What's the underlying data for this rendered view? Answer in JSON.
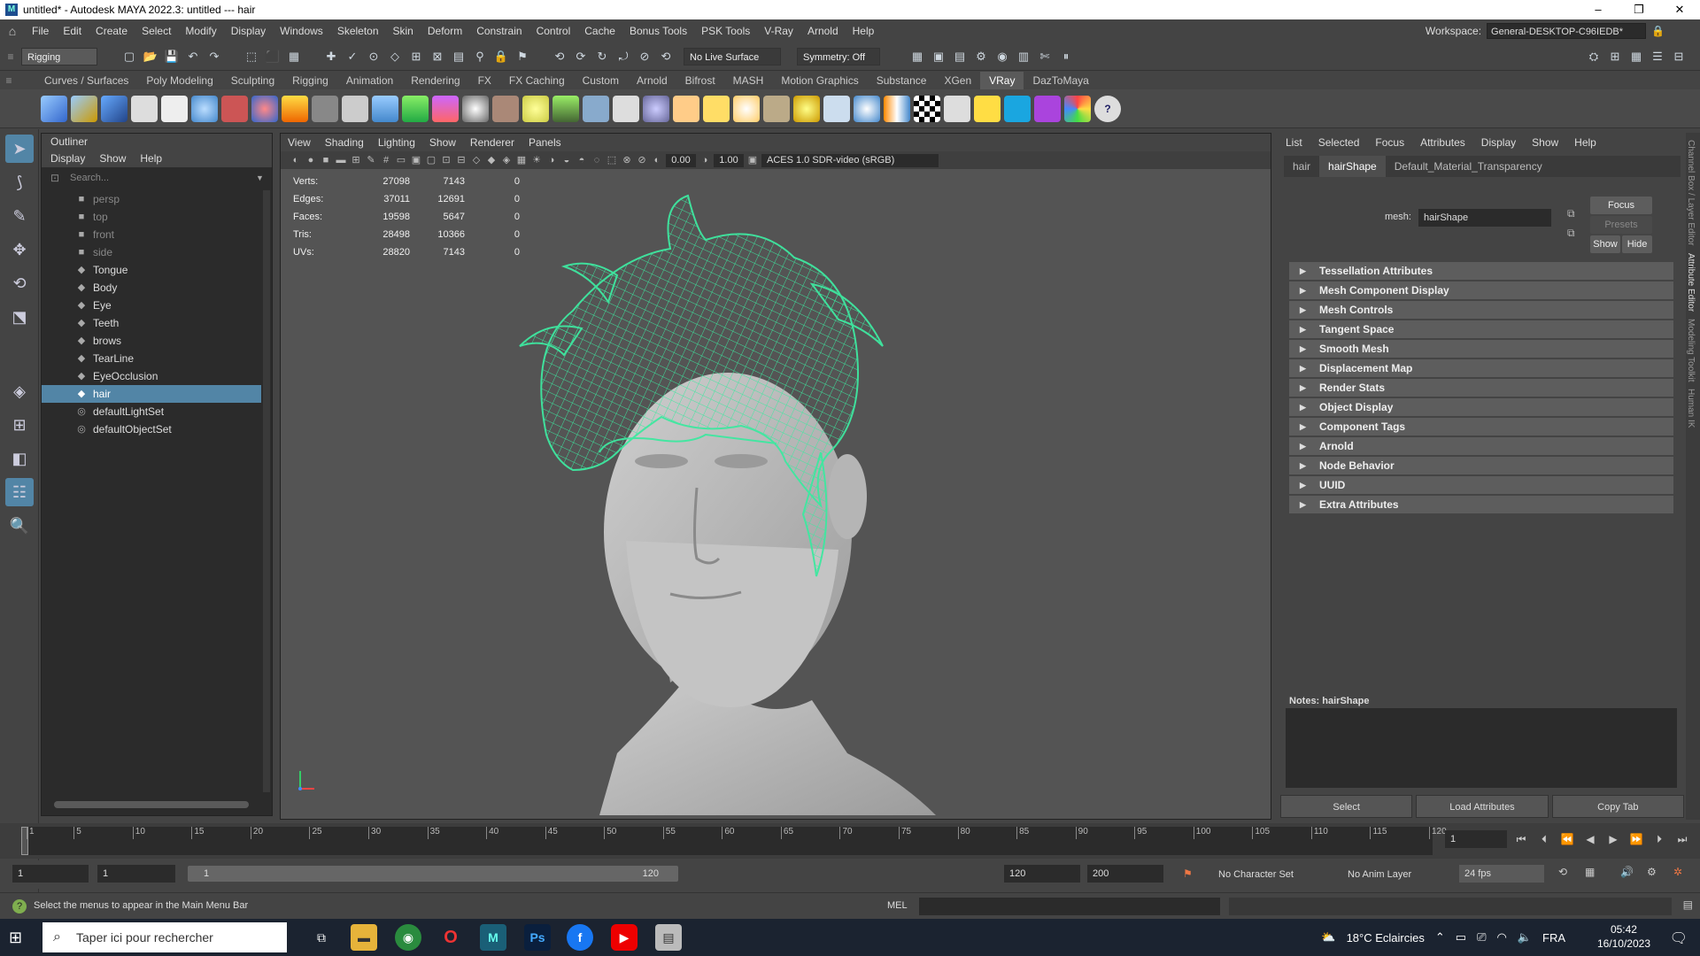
{
  "window": {
    "title": "untitled* - Autodesk MAYA 2022.3: untitled   ---   hair",
    "minimize": "–",
    "restore": "❐",
    "close": "✕"
  },
  "menubar": {
    "items": [
      "File",
      "Edit",
      "Create",
      "Select",
      "Modify",
      "Display",
      "Windows",
      "Skeleton",
      "Skin",
      "Deform",
      "Constrain",
      "Control",
      "Cache",
      "Bonus Tools",
      "PSK Tools",
      "V-Ray",
      "Arnold",
      "Help"
    ],
    "workspace_label": "Workspace:",
    "workspace_value": "General-DESKTOP-C96IEDB*"
  },
  "statusline": {
    "menuset": "Rigging",
    "live_surface": "No Live Surface",
    "symmetry": "Symmetry: Off"
  },
  "shelf_tabs": [
    "Curves / Surfaces",
    "Poly Modeling",
    "Sculpting",
    "Rigging",
    "Animation",
    "Rendering",
    "FX",
    "FX Caching",
    "Custom",
    "Arnold",
    "Bifrost",
    "MASH",
    "Motion Graphics",
    "Substance",
    "XGen",
    "VRay",
    "DazToMaya"
  ],
  "shelf_active_tab": "VRay",
  "outliner": {
    "title": "Outliner",
    "menu": [
      "Display",
      "Show",
      "Help"
    ],
    "search_placeholder": "Search...",
    "items": [
      {
        "label": "persp",
        "type": "camera"
      },
      {
        "label": "top",
        "type": "camera"
      },
      {
        "label": "front",
        "type": "camera"
      },
      {
        "label": "side",
        "type": "camera"
      },
      {
        "label": "Tongue",
        "type": "mesh"
      },
      {
        "label": "Body",
        "type": "mesh"
      },
      {
        "label": "Eye",
        "type": "mesh"
      },
      {
        "label": "Teeth",
        "type": "mesh"
      },
      {
        "label": "brows",
        "type": "mesh"
      },
      {
        "label": "TearLine",
        "type": "mesh"
      },
      {
        "label": "EyeOcclusion",
        "type": "mesh"
      },
      {
        "label": "hair",
        "type": "mesh",
        "selected": true
      },
      {
        "label": "defaultLightSet",
        "type": "set"
      },
      {
        "label": "defaultObjectSet",
        "type": "set"
      }
    ]
  },
  "viewport": {
    "menu": [
      "View",
      "Shading",
      "Lighting",
      "Show",
      "Renderer",
      "Panels"
    ],
    "exposure": "0.00",
    "gamma": "1.00",
    "color_space": "ACES 1.0 SDR-video (sRGB)",
    "hud": [
      {
        "label": "Verts:",
        "a": "27098",
        "b": "7143",
        "c": "0"
      },
      {
        "label": "Edges:",
        "a": "37011",
        "b": "12691",
        "c": "0"
      },
      {
        "label": "Faces:",
        "a": "19598",
        "b": "5647",
        "c": "0"
      },
      {
        "label": "Tris:",
        "a": "28498",
        "b": "10366",
        "c": "0"
      },
      {
        "label": "UVs:",
        "a": "28820",
        "b": "7143",
        "c": "0"
      }
    ],
    "wire_color": "#3ee8a0"
  },
  "attribute_editor": {
    "menu": [
      "List",
      "Selected",
      "Focus",
      "Attributes",
      "Display",
      "Show",
      "Help"
    ],
    "tabs": [
      "hair",
      "hairShape",
      "Default_Material_Transparency"
    ],
    "active_tab": "hairShape",
    "mesh_label": "mesh:",
    "mesh_value": "hairShape",
    "focus": "Focus",
    "presets": "Presets",
    "show": "Show",
    "hide": "Hide",
    "sections": [
      "Tessellation Attributes",
      "Mesh Component Display",
      "Mesh Controls",
      "Tangent Space",
      "Smooth Mesh",
      "Displacement Map",
      "Render Stats",
      "Object Display",
      "Component Tags",
      "Arnold",
      "Node Behavior",
      "UUID",
      "Extra Attributes"
    ],
    "notes_label": "Notes:  hairShape",
    "buttons": [
      "Select",
      "Load Attributes",
      "Copy Tab"
    ]
  },
  "side_tabs": [
    "Channel Box / Layer Editor",
    "Attribute Editor",
    "Modeling Toolkit",
    "Human IK"
  ],
  "timeslider": {
    "ticks": [
      "1",
      "5",
      "10",
      "15",
      "20",
      "25",
      "30",
      "35",
      "40",
      "45",
      "50",
      "55",
      "60",
      "65",
      "70",
      "75",
      "80",
      "85",
      "90",
      "95",
      "100",
      "105",
      "110",
      "115",
      "120"
    ],
    "current_frame": "1"
  },
  "range": {
    "start": "1",
    "playback_start": "1",
    "range_left": "1",
    "range_right": "120",
    "playback_end": "120",
    "end": "200",
    "character_set": "No Character Set",
    "anim_layer": "No Anim Layer",
    "fps": "24 fps"
  },
  "commandline": {
    "help_message": "Select the menus to appear in the Main Menu Bar",
    "mode": "MEL"
  },
  "taskbar": {
    "search_placeholder": "Taper ici pour rechercher",
    "weather": "18°C  Eclaircies",
    "language": "FRA",
    "time": "05:42",
    "date": "16/10/2023"
  }
}
